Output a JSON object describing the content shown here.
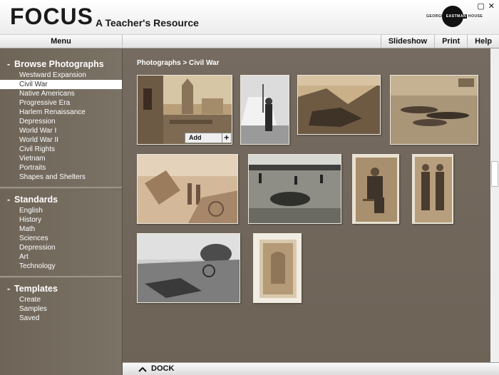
{
  "header": {
    "logo": "FOCUS",
    "subtitle": "A Teacher's Resource",
    "partner_text_left": "GEORGE",
    "partner_text_mid": "EASTMAN",
    "partner_text_right": "HOUSE",
    "window_buttons": [
      "▢",
      "✕"
    ]
  },
  "menubar": {
    "menu": "Menu",
    "slideshow": "Slideshow",
    "print": "Print",
    "help": "Help"
  },
  "sidebar": {
    "browse": {
      "title": "Browse Photographs",
      "items": [
        "Westward Expansion",
        "Civil War",
        "Native Americans",
        "Progressive Era",
        "Harlem Renaissance",
        "Depression",
        "World War I",
        "World War II",
        "Civil Rights",
        "Vietnam",
        "Portraits",
        "Shapes and Shelters"
      ],
      "selected": "Civil War"
    },
    "standards": {
      "title": "Standards",
      "items": [
        "English",
        "History",
        "Math",
        "Sciences",
        "Depression",
        "Art",
        "Technology"
      ]
    },
    "templates": {
      "title": "Templates",
      "items": [
        "Create",
        "Samples",
        "Saved"
      ]
    }
  },
  "main": {
    "breadcrumb": "Photographs > Civil War",
    "add_photo": "Add Photo",
    "add_plus": "+"
  },
  "dock": {
    "label": "DOCK"
  },
  "colors": {
    "sidebar_bg": "#6e6558",
    "main_bg": "#756b60",
    "photo_sepia": "#b79c75"
  },
  "photos": [
    {
      "name": "ruined-church",
      "tone": "sepia"
    },
    {
      "name": "soldier-tent",
      "tone": "bw"
    },
    {
      "name": "trench-field",
      "tone": "sepia"
    },
    {
      "name": "battlefield-dead",
      "tone": "sepia"
    },
    {
      "name": "wagon-wreckage",
      "tone": "sepia-light"
    },
    {
      "name": "field-horses",
      "tone": "bw"
    },
    {
      "name": "seated-soldier",
      "tone": "sepia-card"
    },
    {
      "name": "two-soldiers",
      "tone": "sepia-card"
    },
    {
      "name": "engraving-battle",
      "tone": "bw"
    },
    {
      "name": "framed-portrait",
      "tone": "sepia-card"
    }
  ]
}
